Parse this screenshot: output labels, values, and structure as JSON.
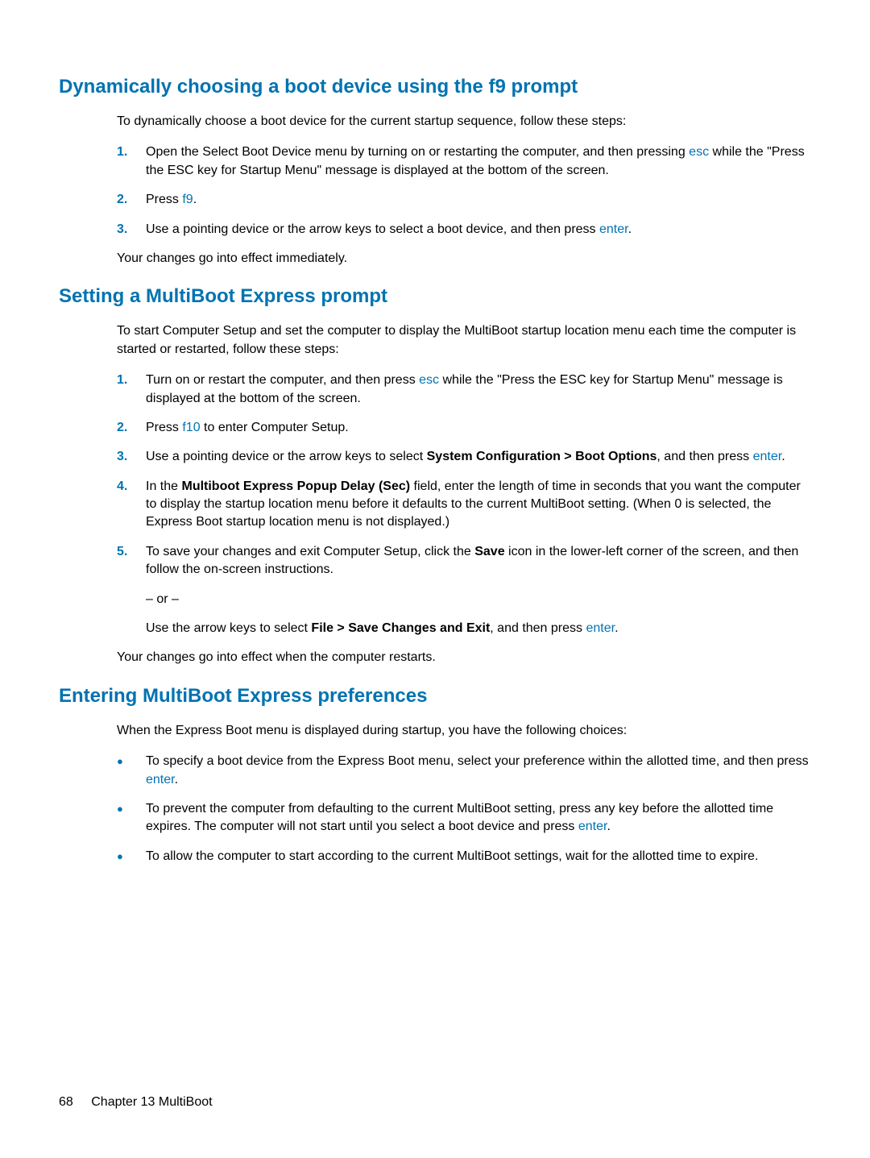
{
  "section1": {
    "heading": "Dynamically choosing a boot device using the f9 prompt",
    "intro": "To dynamically choose a boot device for the current startup sequence, follow these steps:",
    "steps": [
      {
        "num": "1.",
        "parts": [
          {
            "t": "Open the Select Boot Device menu by turning on or restarting the computer, and then pressing "
          },
          {
            "t": "esc",
            "key": true
          },
          {
            "t": " while the \"Press the ESC key for Startup Menu\" message is displayed at the bottom of the screen."
          }
        ]
      },
      {
        "num": "2.",
        "parts": [
          {
            "t": "Press "
          },
          {
            "t": "f9",
            "key": true
          },
          {
            "t": "."
          }
        ]
      },
      {
        "num": "3.",
        "parts": [
          {
            "t": "Use a pointing device or the arrow keys to select a boot device, and then press "
          },
          {
            "t": "enter",
            "key": true
          },
          {
            "t": "."
          }
        ]
      }
    ],
    "outro": "Your changes go into effect immediately."
  },
  "section2": {
    "heading": "Setting a MultiBoot Express prompt",
    "intro": "To start Computer Setup and set the computer to display the MultiBoot startup location menu each time the computer is started or restarted, follow these steps:",
    "steps": [
      {
        "num": "1.",
        "parts": [
          {
            "t": "Turn on or restart the computer, and then press "
          },
          {
            "t": "esc",
            "key": true
          },
          {
            "t": " while the \"Press the ESC key for Startup Menu\" message is displayed at the bottom of the screen."
          }
        ]
      },
      {
        "num": "2.",
        "parts": [
          {
            "t": "Press "
          },
          {
            "t": "f10",
            "key": true
          },
          {
            "t": " to enter Computer Setup."
          }
        ]
      },
      {
        "num": "3.",
        "parts": [
          {
            "t": "Use a pointing device or the arrow keys to select "
          },
          {
            "t": "System Configuration > Boot Options",
            "bold": true
          },
          {
            "t": ", and then press "
          },
          {
            "t": "enter",
            "key": true
          },
          {
            "t": "."
          }
        ]
      },
      {
        "num": "4.",
        "parts": [
          {
            "t": "In the "
          },
          {
            "t": "Multiboot Express Popup Delay (Sec)",
            "bold": true
          },
          {
            "t": " field, enter the length of time in seconds that you want the computer to display the startup location menu before it defaults to the current MultiBoot setting. (When 0 is selected, the Express Boot startup location menu is not displayed.)"
          }
        ]
      },
      {
        "num": "5.",
        "parts": [
          {
            "t": "To save your changes and exit Computer Setup, click the "
          },
          {
            "t": "Save",
            "bold": true
          },
          {
            "t": " icon in the lower-left corner of the screen, and then follow the on-screen instructions."
          }
        ]
      }
    ],
    "orText": "– or –",
    "orLine": [
      {
        "t": "Use the arrow keys to select "
      },
      {
        "t": "File > Save Changes and Exit",
        "bold": true
      },
      {
        "t": ", and then press "
      },
      {
        "t": "enter",
        "key": true
      },
      {
        "t": "."
      }
    ],
    "outro": "Your changes go into effect when the computer restarts."
  },
  "section3": {
    "heading": "Entering MultiBoot Express preferences",
    "intro": "When the Express Boot menu is displayed during startup, you have the following choices:",
    "bullets": [
      {
        "parts": [
          {
            "t": "To specify a boot device from the Express Boot menu, select your preference within the allotted time, and then press "
          },
          {
            "t": "enter",
            "key": true
          },
          {
            "t": "."
          }
        ]
      },
      {
        "parts": [
          {
            "t": "To prevent the computer from defaulting to the current MultiBoot setting, press any key before the allotted time expires. The computer will not start until you select a boot device and press "
          },
          {
            "t": "enter",
            "key": true
          },
          {
            "t": "."
          }
        ]
      },
      {
        "parts": [
          {
            "t": "To allow the computer to start according to the current MultiBoot settings, wait for the allotted time to expire."
          }
        ]
      }
    ]
  },
  "footer": {
    "pageNum": "68",
    "chapter": "Chapter 13   MultiBoot"
  }
}
